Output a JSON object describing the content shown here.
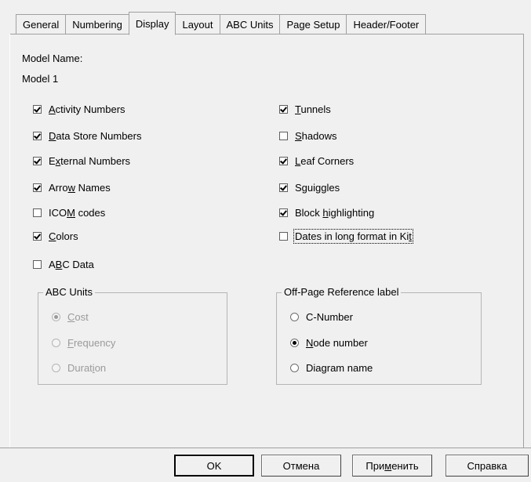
{
  "tabs": [
    {
      "label": "General",
      "active": false
    },
    {
      "label": "Numbering",
      "active": false
    },
    {
      "label": "Display",
      "active": true
    },
    {
      "label": "Layout",
      "active": false
    },
    {
      "label": "ABC Units",
      "active": false
    },
    {
      "label": "Page Setup",
      "active": false
    },
    {
      "label": "Header/Footer",
      "active": false
    }
  ],
  "model": {
    "name_label": "Model Name:",
    "name_value": "Model 1"
  },
  "left_checks": [
    {
      "pre": "",
      "key": "A",
      "post": "ctivity Numbers",
      "checked": true
    },
    {
      "pre": "",
      "key": "D",
      "post": "ata Store Numbers",
      "checked": true
    },
    {
      "pre": "E",
      "key": "x",
      "post": "ternal Numbers",
      "checked": true
    },
    {
      "pre": "Arro",
      "key": "w",
      "post": " Names",
      "checked": true
    },
    {
      "pre": "ICO",
      "key": "M",
      "post": " codes",
      "checked": false
    },
    {
      "pre": "",
      "key": "C",
      "post": "olors",
      "checked": true
    },
    {
      "pre": "A",
      "key": "B",
      "post": "C Data",
      "checked": false
    }
  ],
  "right_checks": [
    {
      "pre": "",
      "key": "T",
      "post": "unnels",
      "checked": true
    },
    {
      "pre": "",
      "key": "S",
      "post": "hadows",
      "checked": false
    },
    {
      "pre": "",
      "key": "L",
      "post": "eaf Corners",
      "checked": true
    },
    {
      "pre": "S",
      "key": "g",
      "post": "uiggles",
      "checked": true
    },
    {
      "pre": "Block ",
      "key": "h",
      "post": "ighlighting",
      "checked": true
    },
    {
      "pre": "Dates in long format in Ki",
      "key": "t",
      "post": "",
      "checked": false
    }
  ],
  "abc_units": {
    "legend": "ABC Units",
    "options": [
      {
        "pre": "",
        "key": "C",
        "post": "ost",
        "selected": true
      },
      {
        "pre": "",
        "key": "F",
        "post": "requency",
        "selected": false
      },
      {
        "pre": "Durat",
        "key": "i",
        "post": "on",
        "selected": false
      }
    ]
  },
  "offpage": {
    "legend": "Off-Page Reference label",
    "options": [
      {
        "pre": "C-Number",
        "key": "",
        "post": "",
        "selected": false
      },
      {
        "pre": "",
        "key": "N",
        "post": "ode number",
        "selected": true
      },
      {
        "pre": "Diagram name",
        "key": "",
        "post": "",
        "selected": false
      }
    ]
  },
  "buttons": {
    "ok": "OK",
    "cancel": "Отмена",
    "apply_pre": "При",
    "apply_key": "м",
    "apply_post": "енить",
    "help": "Справка"
  }
}
